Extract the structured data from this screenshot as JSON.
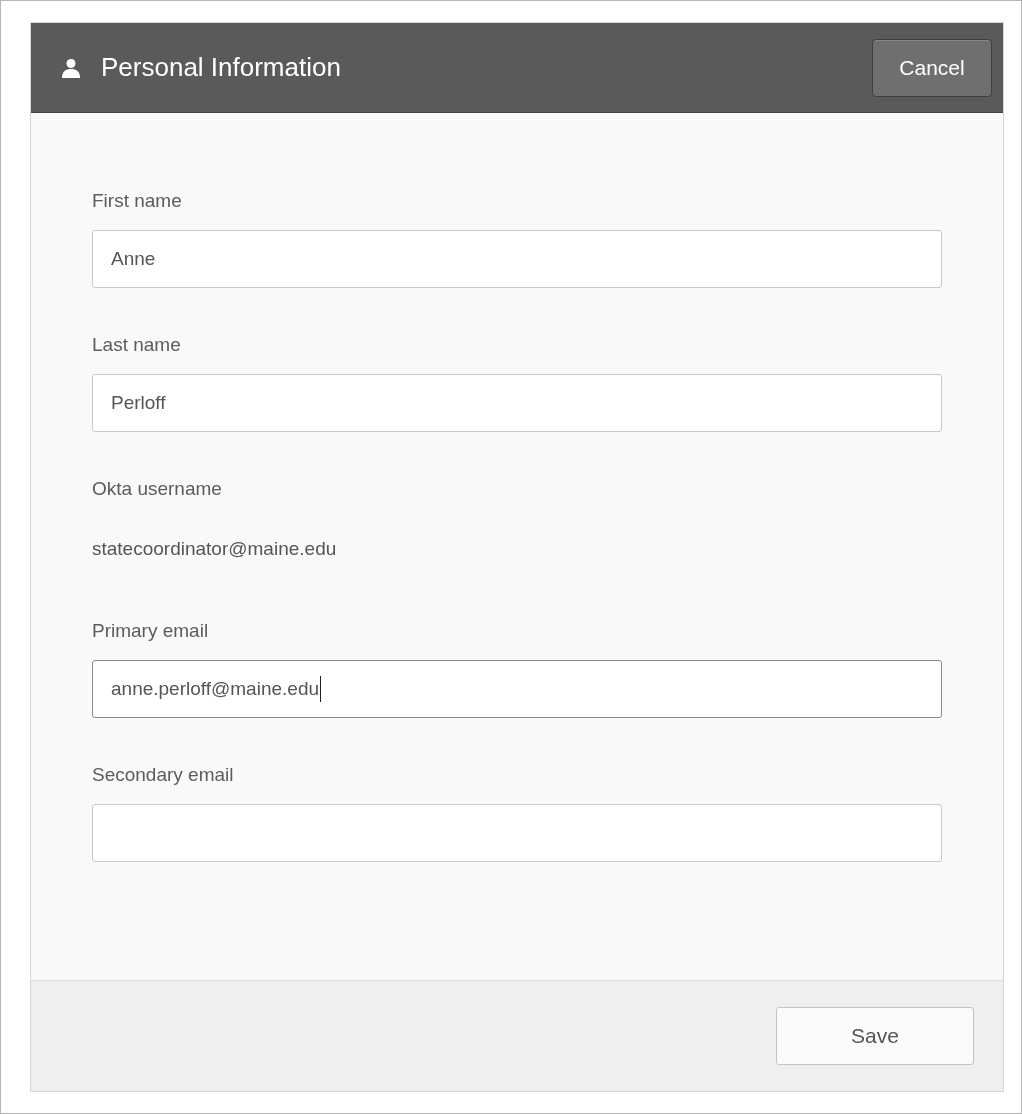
{
  "panel": {
    "title": "Personal Information",
    "cancel_button": "Cancel"
  },
  "fields": [
    {
      "kind": "input",
      "label": "First name",
      "value": "Anne",
      "focused": false
    },
    {
      "kind": "input",
      "label": "Last name",
      "value": "Perloff",
      "focused": false
    },
    {
      "kind": "text",
      "label": "Okta username",
      "value": "statecoordinator@maine.edu"
    },
    {
      "kind": "input",
      "label": "Primary email",
      "value": "anne.perloff@maine.edu",
      "focused": true
    },
    {
      "kind": "input",
      "label": "Secondary email",
      "focused": false
    }
  ],
  "footer": {
    "save_button": "Save"
  }
}
